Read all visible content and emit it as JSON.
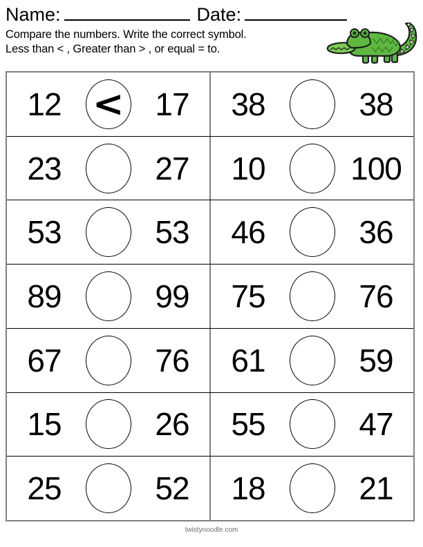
{
  "header": {
    "name_label": "Name:",
    "date_label": "Date:",
    "instruction_line_1": "Compare the numbers. Write the correct symbol.",
    "instruction_line_2": "Less than < , Greater than > , or equal  = to."
  },
  "decoration": {
    "mascot": "alligator-illustration",
    "body_color": "#5fb842",
    "belly_color": "#7ecb58",
    "outline_color": "#1f1f1f",
    "eye_color": "#1f3a1a",
    "spike_color": "#e9ece4"
  },
  "worksheet": {
    "rows": [
      {
        "left": {
          "first": "12",
          "symbol": "<",
          "second": "17"
        },
        "right": {
          "first": "38",
          "symbol": "",
          "second": "38"
        }
      },
      {
        "left": {
          "first": "23",
          "symbol": "",
          "second": "27"
        },
        "right": {
          "first": "10",
          "symbol": "",
          "second": "100"
        }
      },
      {
        "left": {
          "first": "53",
          "symbol": "",
          "second": "53"
        },
        "right": {
          "first": "46",
          "symbol": "",
          "second": "36"
        }
      },
      {
        "left": {
          "first": "89",
          "symbol": "",
          "second": "99"
        },
        "right": {
          "first": "75",
          "symbol": "",
          "second": "76"
        }
      },
      {
        "left": {
          "first": "67",
          "symbol": "",
          "second": "76"
        },
        "right": {
          "first": "61",
          "symbol": "",
          "second": "59"
        }
      },
      {
        "left": {
          "first": "15",
          "symbol": "",
          "second": "26"
        },
        "right": {
          "first": "55",
          "symbol": "",
          "second": "47"
        }
      },
      {
        "left": {
          "first": "25",
          "symbol": "",
          "second": "52"
        },
        "right": {
          "first": "18",
          "symbol": "",
          "second": "21"
        }
      }
    ]
  },
  "footer": {
    "credit": "twistynoodle.com"
  }
}
